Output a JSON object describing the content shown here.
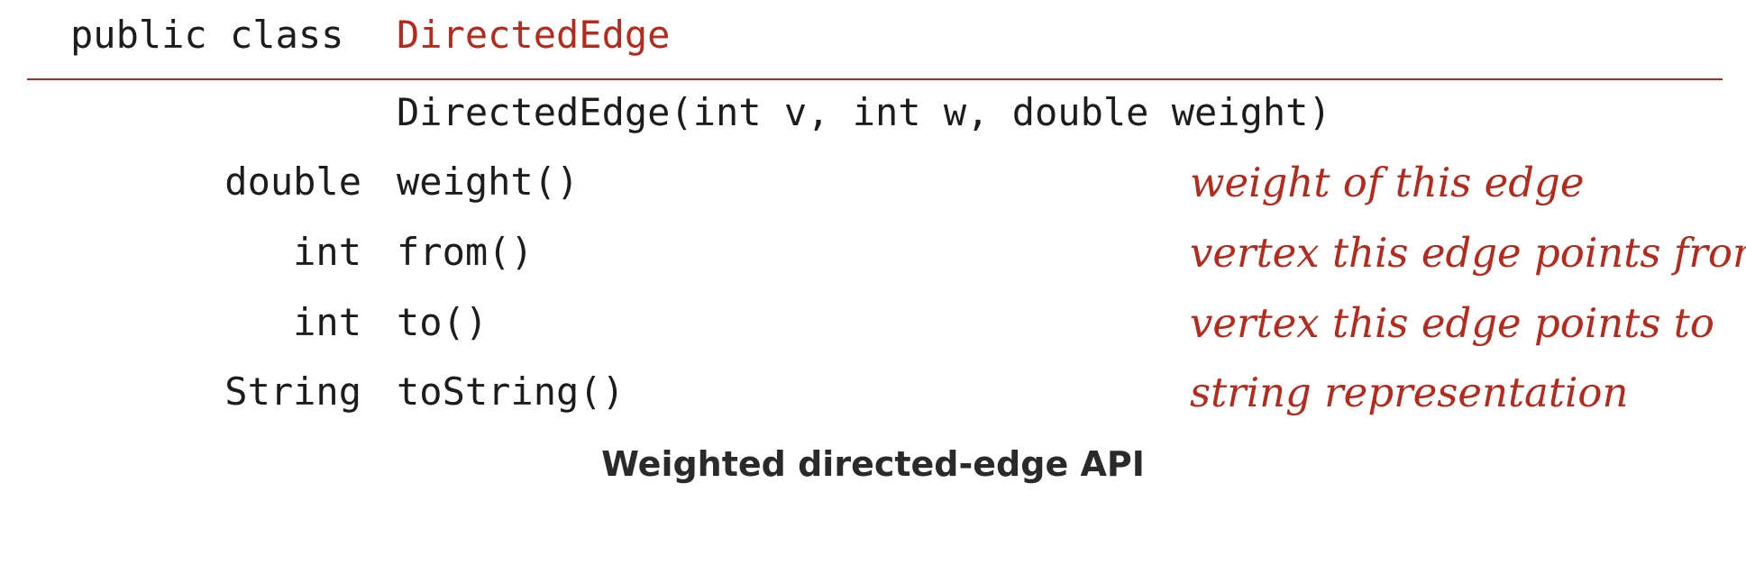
{
  "header": {
    "keywords": "public class",
    "class_name": "DirectedEdge"
  },
  "constructor": {
    "signature": "DirectedEdge(int v, int w, double weight)"
  },
  "methods": [
    {
      "return_type": "double",
      "signature": "weight()",
      "description": "weight of this edge"
    },
    {
      "return_type": "int",
      "signature": "from()",
      "description": "vertex this edge points from"
    },
    {
      "return_type": "int",
      "signature": "to()",
      "description": "vertex this edge points to"
    },
    {
      "return_type": "String",
      "signature": "toString()",
      "description": "string representation"
    }
  ],
  "caption": "Weighted directed-edge API",
  "colors": {
    "accent": "#b52a1c",
    "text": "#1c1c1c"
  }
}
